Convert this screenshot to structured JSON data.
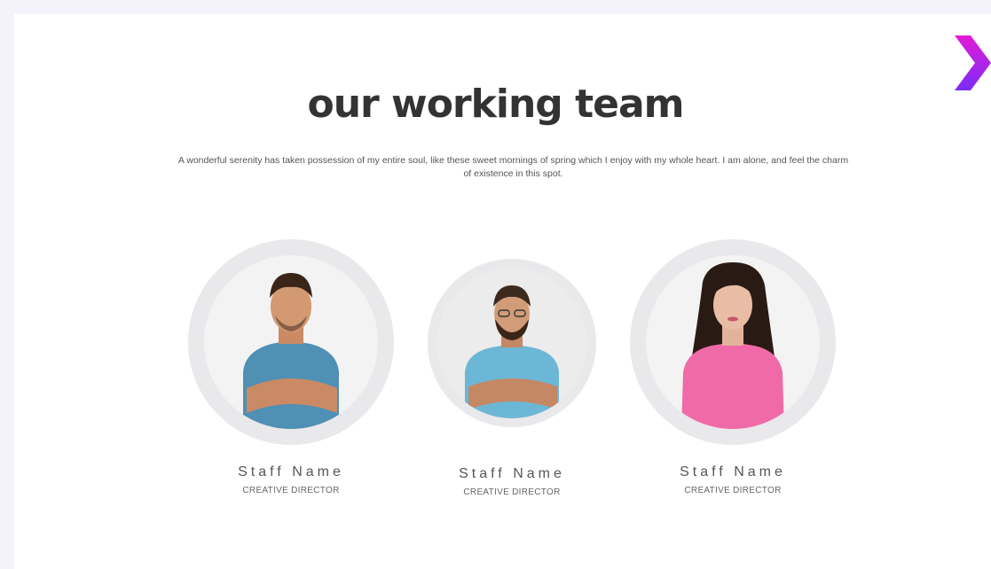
{
  "section": {
    "title": "our working team",
    "description": "A wonderful serenity has taken possession of my entire soul, like these sweet mornings of spring which I enjoy with my whole heart. I am alone, and feel the charm of existence in this spot."
  },
  "navigation": {
    "next_icon": "chevron-right-icon",
    "accent_colors": [
      "#e21bd6",
      "#7b2cf5"
    ]
  },
  "team": [
    {
      "name": "Staff Name",
      "role": "CREATIVE DIRECTOR",
      "shirt_color": "#4f90b4"
    },
    {
      "name": "Staff Name",
      "role": "CREATIVE DIRECTOR",
      "shirt_color": "#6cb7d6"
    },
    {
      "name": "Staff Name",
      "role": "CREATIVE DIRECTOR",
      "shirt_color": "#f06aa7"
    }
  ]
}
